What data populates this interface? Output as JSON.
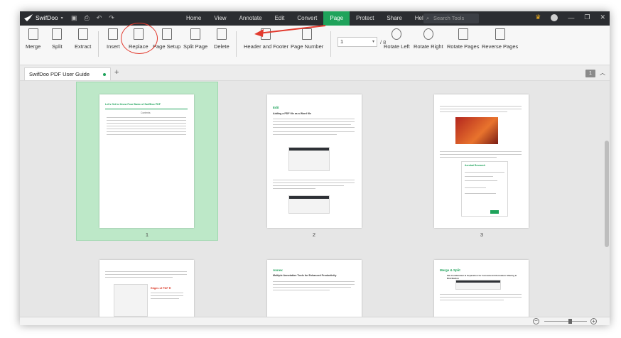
{
  "app": {
    "name": "SwifDoo"
  },
  "menu": {
    "items": [
      "Home",
      "View",
      "Annotate",
      "Edit",
      "Convert",
      "Page",
      "Protect",
      "Share",
      "Help"
    ],
    "active": "Page",
    "search_placeholder": "Search Tools"
  },
  "ribbon": {
    "merge": "Merge",
    "split": "Split",
    "extract": "Extract",
    "insert": "Insert",
    "replace": "Replace",
    "page_setup": "Page Setup",
    "split_page": "Split Page",
    "delete": "Delete",
    "header_footer": "Header and Footer",
    "page_number": "Page Number",
    "current_page": "1",
    "total_pages": "/ 8",
    "rotate_left": "Rotate Left",
    "rotate_right": "Rotate Right",
    "rotate_pages": "Rotate Pages",
    "reverse_pages": "Reverse Pages"
  },
  "tabs": {
    "doc_title": "SwifDoo PDF User Guide",
    "add": "+",
    "page_count_badge": "1"
  },
  "thumbnails": {
    "labels": [
      "1",
      "2",
      "3"
    ],
    "p1": {
      "title": "Let's Get to Know Four Basic of SwifDoo PDF",
      "toc": "Contents"
    },
    "p2": {
      "heading": "Edit",
      "sub": "Adding a PDF file as a Word file"
    },
    "p3": {
      "sub": "Acrobat Research"
    },
    "p4": {
      "callout": "Edges of PDF R"
    },
    "p5": {
      "heading": "Annex",
      "sub": "Multiple Annotation Tools for Enhanced Productivity"
    },
    "p6": {
      "heading": "Merge & Split",
      "sub": "File Combination & Separation for Convenient Information Sharing & Distribution"
    }
  },
  "colors": {
    "accent": "#1fa35b",
    "annotation": "#e23a2e",
    "titlebar": "#2b2d31"
  }
}
